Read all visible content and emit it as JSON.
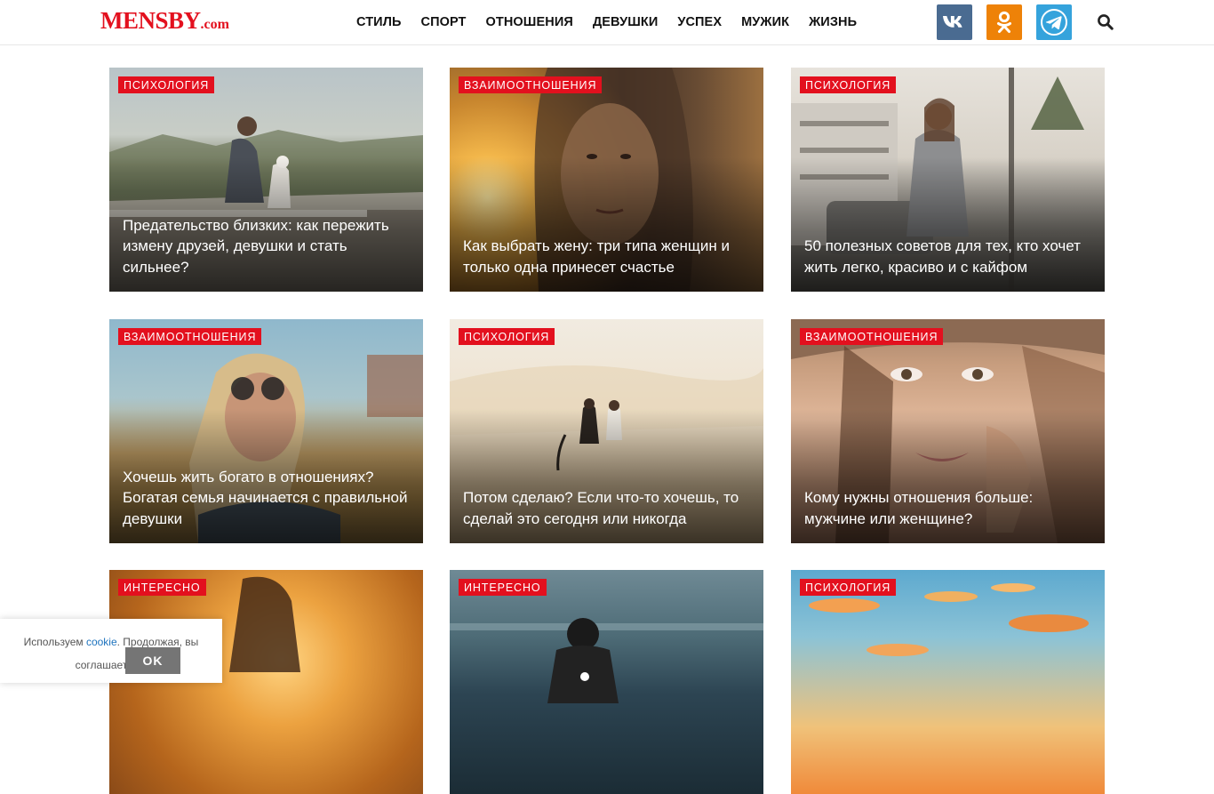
{
  "header": {
    "logo_main": "MENSBY",
    "logo_domain": ".com",
    "nav": [
      "СТИЛЬ",
      "СПОРТ",
      "ОТНОШЕНИЯ",
      "ДЕВУШКИ",
      "УСПЕХ",
      "МУЖИК",
      "ЖИЗНЬ"
    ],
    "social_icons": [
      "vk-icon",
      "odnoklassniki-icon",
      "telegram-icon"
    ],
    "search_icon": "search-icon"
  },
  "colors": {
    "brand_red": "#e3101e",
    "vk": "#4a6b91",
    "ok": "#ee8208",
    "telegram": "#35a3dc"
  },
  "cards": [
    {
      "category": "ПСИХОЛОГИЯ",
      "title": "Предательство близких: как пережить измену друзей, девушки и стать сильнее?"
    },
    {
      "category": "ВЗАИМООТНОШЕНИЯ",
      "title": "Как выбрать жену: три типа женщин и только одна принесет счастье"
    },
    {
      "category": "ПСИХОЛОГИЯ",
      "title": "50 полезных советов для тех, кто хочет жить легко, красиво и с кайфом"
    },
    {
      "category": "ВЗАИМООТНОШЕНИЯ",
      "title": "Хочешь жить богато в отношениях? Богатая семья начинается с правильной девушки"
    },
    {
      "category": "ПСИХОЛОГИЯ",
      "title": "Потом сделаю? Если что-то хочешь, то сделай это сегодня или никогда"
    },
    {
      "category": "ВЗАИМООТНОШЕНИЯ",
      "title": "Кому нужны отношения больше: мужчине или женщине?"
    },
    {
      "category": "ИНТЕРЕСНО",
      "title": ""
    },
    {
      "category": "ИНТЕРЕСНО",
      "title": ""
    },
    {
      "category": "ПСИХОЛОГИЯ",
      "title": ""
    }
  ],
  "cookie": {
    "text_before": "Используем ",
    "link": "cookie",
    "text_after": ". Продолжая, вы соглашаетесь.",
    "button": "OK"
  }
}
